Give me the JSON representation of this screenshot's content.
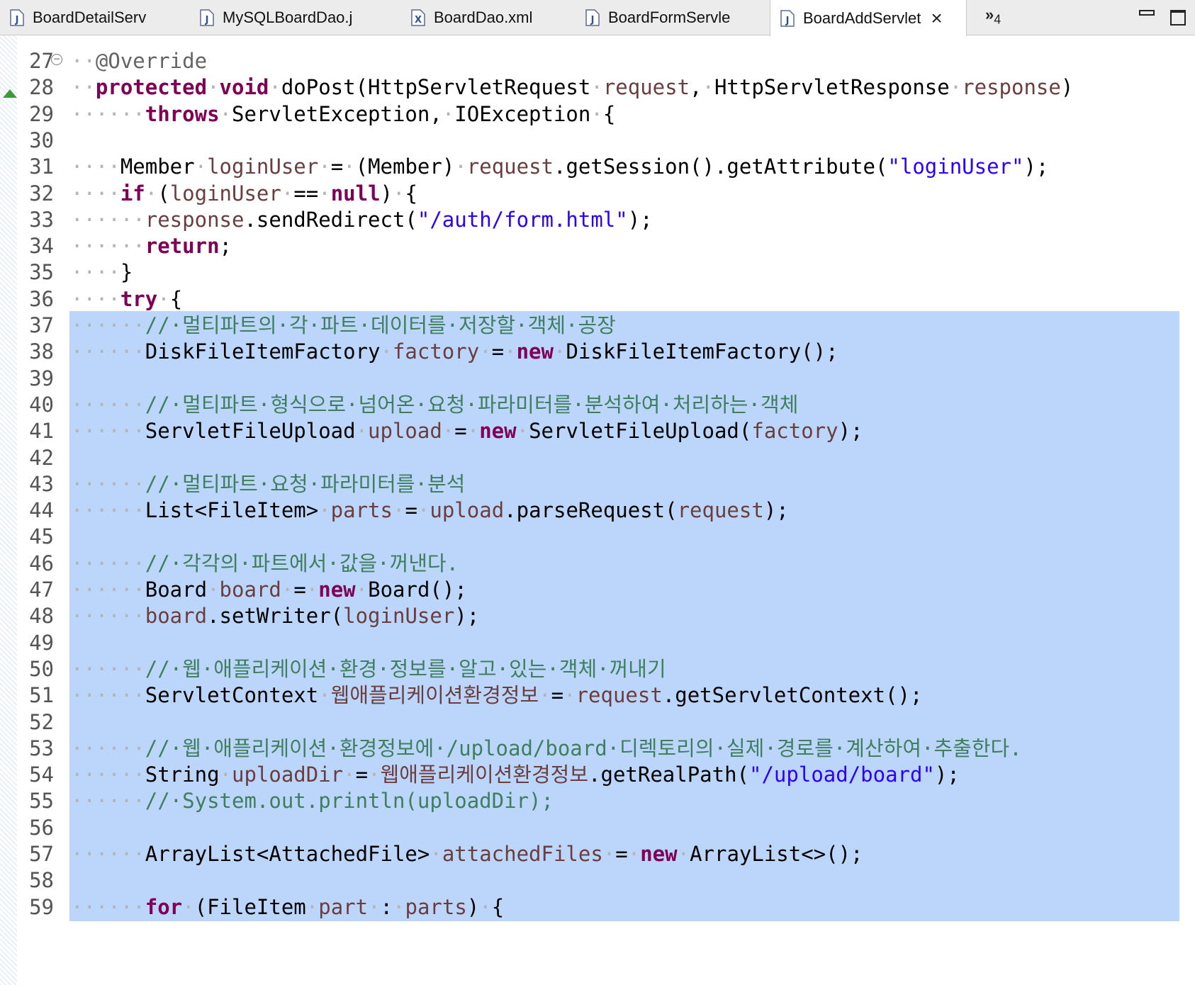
{
  "tabs": [
    {
      "label": "BoardDetailServ",
      "icon": "java-file-icon",
      "active": false
    },
    {
      "label": "MySQLBoardDao.j",
      "icon": "java-file-icon",
      "active": false
    },
    {
      "label": "BoardDao.xml",
      "icon": "xml-file-icon",
      "active": false
    },
    {
      "label": "BoardFormServle",
      "icon": "java-file-icon",
      "active": false
    },
    {
      "label": "BoardAddServlet",
      "icon": "java-file-icon",
      "active": true
    }
  ],
  "overflow": {
    "symbol": "»",
    "count": "4"
  },
  "editor": {
    "first_line": 27,
    "selection": {
      "from": 37,
      "to": 59
    },
    "lines": [
      [
        [
          "ws",
          "··"
        ],
        [
          "ann",
          "@Override"
        ]
      ],
      [
        [
          "ws",
          "··"
        ],
        [
          "kw",
          "protected"
        ],
        [
          "ws",
          "·"
        ],
        [
          "kw",
          "void"
        ],
        [
          "ws",
          "·"
        ],
        [
          "p",
          "doPost(HttpServletRequest"
        ],
        [
          "ws",
          "·"
        ],
        [
          "fld",
          "request"
        ],
        [
          "p",
          ","
        ],
        [
          "ws",
          "·"
        ],
        [
          "p",
          "HttpServletResponse"
        ],
        [
          "ws",
          "·"
        ],
        [
          "fld",
          "response"
        ],
        [
          "p",
          ")"
        ]
      ],
      [
        [
          "ws",
          "······"
        ],
        [
          "kw",
          "throws"
        ],
        [
          "ws",
          "·"
        ],
        [
          "p",
          "ServletException,"
        ],
        [
          "ws",
          "·"
        ],
        [
          "p",
          "IOException"
        ],
        [
          "ws",
          "·"
        ],
        [
          "p",
          "{"
        ]
      ],
      [],
      [
        [
          "ws",
          "····"
        ],
        [
          "p",
          "Member"
        ],
        [
          "ws",
          "·"
        ],
        [
          "fld",
          "loginUser"
        ],
        [
          "ws",
          "·"
        ],
        [
          "p",
          "="
        ],
        [
          "ws",
          "·"
        ],
        [
          "p",
          "(Member)"
        ],
        [
          "ws",
          "·"
        ],
        [
          "fld",
          "request"
        ],
        [
          "p",
          ".getSession().getAttribute("
        ],
        [
          "str",
          "\"loginUser\""
        ],
        [
          "p",
          ");"
        ]
      ],
      [
        [
          "ws",
          "····"
        ],
        [
          "kw",
          "if"
        ],
        [
          "ws",
          "·"
        ],
        [
          "p",
          "("
        ],
        [
          "fld",
          "loginUser"
        ],
        [
          "ws",
          "·"
        ],
        [
          "p",
          "=="
        ],
        [
          "ws",
          "·"
        ],
        [
          "kw",
          "null"
        ],
        [
          "p",
          ")"
        ],
        [
          "ws",
          "·"
        ],
        [
          "p",
          "{"
        ]
      ],
      [
        [
          "ws",
          "······"
        ],
        [
          "fld",
          "response"
        ],
        [
          "p",
          ".sendRedirect("
        ],
        [
          "str",
          "\"/auth/form.html\""
        ],
        [
          "p",
          ");"
        ]
      ],
      [
        [
          "ws",
          "······"
        ],
        [
          "kw",
          "return"
        ],
        [
          "p",
          ";"
        ]
      ],
      [
        [
          "ws",
          "····"
        ],
        [
          "p",
          "}"
        ]
      ],
      [
        [
          "ws",
          "····"
        ],
        [
          "kw",
          "try"
        ],
        [
          "ws",
          "·"
        ],
        [
          "p",
          "{"
        ]
      ],
      [
        [
          "ws",
          "······"
        ],
        [
          "cm",
          "//·멀티파트의·각·파트·데이터를·저장할·객체·공장"
        ]
      ],
      [
        [
          "ws",
          "······"
        ],
        [
          "p",
          "DiskFileItemFactory"
        ],
        [
          "ws",
          "·"
        ],
        [
          "fld",
          "factory"
        ],
        [
          "ws",
          "·"
        ],
        [
          "p",
          "="
        ],
        [
          "ws",
          "·"
        ],
        [
          "kw",
          "new"
        ],
        [
          "ws",
          "·"
        ],
        [
          "p",
          "DiskFileItemFactory();"
        ]
      ],
      [],
      [
        [
          "ws",
          "······"
        ],
        [
          "cm",
          "//·멀티파트·형식으로·넘어온·요청·파라미터를·분석하여·처리하는·객체"
        ]
      ],
      [
        [
          "ws",
          "······"
        ],
        [
          "p",
          "ServletFileUpload"
        ],
        [
          "ws",
          "·"
        ],
        [
          "fld",
          "upload"
        ],
        [
          "ws",
          "·"
        ],
        [
          "p",
          "="
        ],
        [
          "ws",
          "·"
        ],
        [
          "kw",
          "new"
        ],
        [
          "ws",
          "·"
        ],
        [
          "p",
          "ServletFileUpload("
        ],
        [
          "fld",
          "factory"
        ],
        [
          "p",
          ");"
        ]
      ],
      [],
      [
        [
          "ws",
          "······"
        ],
        [
          "cm",
          "//·멀티파트·요청·파라미터를·분석"
        ]
      ],
      [
        [
          "ws",
          "······"
        ],
        [
          "p",
          "List<FileItem>"
        ],
        [
          "ws",
          "·"
        ],
        [
          "fld",
          "parts"
        ],
        [
          "ws",
          "·"
        ],
        [
          "p",
          "="
        ],
        [
          "ws",
          "·"
        ],
        [
          "fld",
          "upload"
        ],
        [
          "p",
          ".parseRequest("
        ],
        [
          "fld",
          "request"
        ],
        [
          "p",
          ");"
        ]
      ],
      [],
      [
        [
          "ws",
          "······"
        ],
        [
          "cm",
          "//·각각의·파트에서·값을·꺼낸다."
        ]
      ],
      [
        [
          "ws",
          "······"
        ],
        [
          "p",
          "Board"
        ],
        [
          "ws",
          "·"
        ],
        [
          "fld",
          "board"
        ],
        [
          "ws",
          "·"
        ],
        [
          "p",
          "="
        ],
        [
          "ws",
          "·"
        ],
        [
          "kw",
          "new"
        ],
        [
          "ws",
          "·"
        ],
        [
          "p",
          "Board();"
        ]
      ],
      [
        [
          "ws",
          "······"
        ],
        [
          "fld",
          "board"
        ],
        [
          "p",
          ".setWriter("
        ],
        [
          "fld",
          "loginUser"
        ],
        [
          "p",
          ");"
        ]
      ],
      [],
      [
        [
          "ws",
          "······"
        ],
        [
          "cm",
          "//·웹·애플리케이션·환경·정보를·알고·있는·객체·꺼내기"
        ]
      ],
      [
        [
          "ws",
          "······"
        ],
        [
          "p",
          "ServletContext"
        ],
        [
          "ws",
          "·"
        ],
        [
          "fld",
          "웹애플리케이션환경정보"
        ],
        [
          "ws",
          "·"
        ],
        [
          "p",
          "="
        ],
        [
          "ws",
          "·"
        ],
        [
          "fld",
          "request"
        ],
        [
          "p",
          ".getServletContext();"
        ]
      ],
      [],
      [
        [
          "ws",
          "······"
        ],
        [
          "cm",
          "//·웹·애플리케이션·환경정보에·/upload/board·디렉토리의·실제·경로를·계산하여·추출한다."
        ]
      ],
      [
        [
          "ws",
          "······"
        ],
        [
          "p",
          "String"
        ],
        [
          "ws",
          "·"
        ],
        [
          "fld",
          "uploadDir"
        ],
        [
          "ws",
          "·"
        ],
        [
          "p",
          "="
        ],
        [
          "ws",
          "·"
        ],
        [
          "fld",
          "웹애플리케이션환경정보"
        ],
        [
          "p",
          ".getRealPath("
        ],
        [
          "str",
          "\"/upload/board\""
        ],
        [
          "p",
          ");"
        ]
      ],
      [
        [
          "ws",
          "······"
        ],
        [
          "cm",
          "//·System.out.println(uploadDir);"
        ]
      ],
      [],
      [
        [
          "ws",
          "······"
        ],
        [
          "p",
          "ArrayList<AttachedFile>"
        ],
        [
          "ws",
          "·"
        ],
        [
          "fld",
          "attachedFiles"
        ],
        [
          "ws",
          "·"
        ],
        [
          "p",
          "="
        ],
        [
          "ws",
          "·"
        ],
        [
          "kw",
          "new"
        ],
        [
          "ws",
          "·"
        ],
        [
          "p",
          "ArrayList<>();"
        ]
      ],
      [],
      [
        [
          "ws",
          "······"
        ],
        [
          "kw",
          "for"
        ],
        [
          "ws",
          "·"
        ],
        [
          "p",
          "(FileItem"
        ],
        [
          "ws",
          "·"
        ],
        [
          "fld",
          "part"
        ],
        [
          "ws",
          "·"
        ],
        [
          "p",
          ":"
        ],
        [
          "ws",
          "·"
        ],
        [
          "fld",
          "parts"
        ],
        [
          "p",
          ")"
        ],
        [
          "ws",
          "·"
        ],
        [
          "p",
          "{"
        ]
      ]
    ]
  }
}
